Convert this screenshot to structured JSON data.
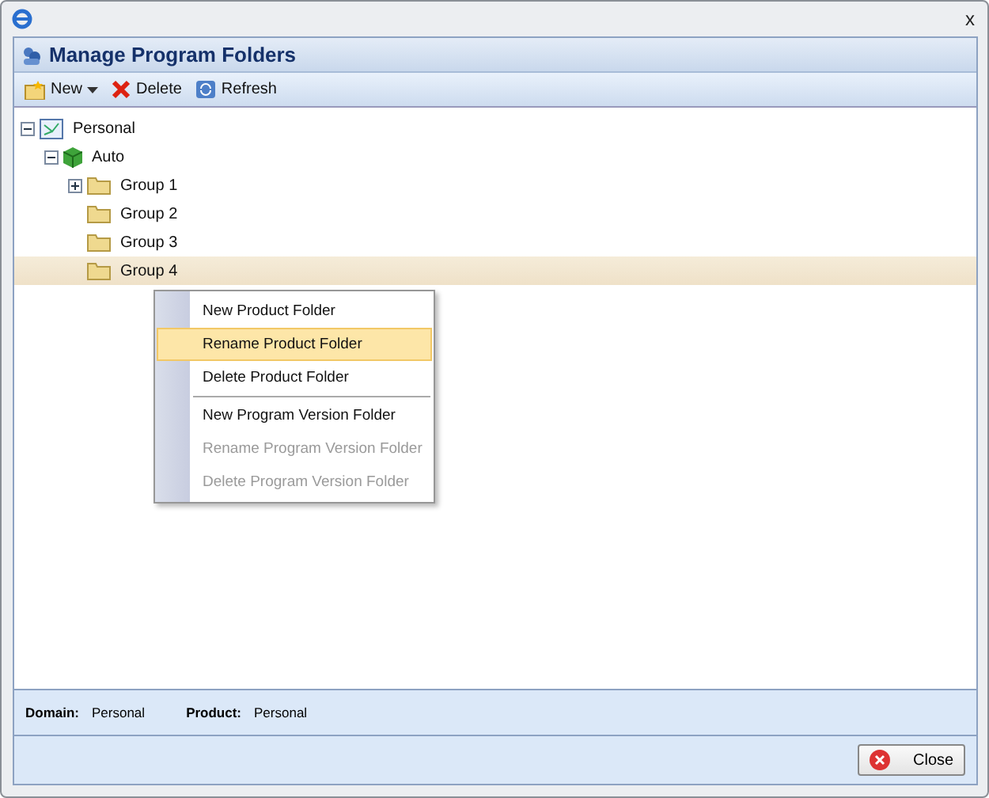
{
  "window": {
    "title": "Manage Program Folders",
    "close": "x"
  },
  "toolbar": [
    {
      "kind": "new",
      "label": "New",
      "dropdown": true
    },
    {
      "kind": "delete",
      "label": "Delete"
    },
    {
      "kind": "refresh",
      "label": "Refresh"
    }
  ],
  "tree": [
    {
      "label": "Personal",
      "kind": "domain",
      "expanded": true,
      "selected": false,
      "children": [
        {
          "label": "Auto",
          "kind": "product",
          "expanded": true,
          "selected": false,
          "children": [
            {
              "label": "Group 1",
              "kind": "folder",
              "expanded": false,
              "selected": false
            },
            {
              "label": "Group 2",
              "kind": "folder",
              "selected": false
            },
            {
              "label": "Group 3",
              "kind": "folder",
              "selected": false
            },
            {
              "label": "Group 4",
              "kind": "folder",
              "selected": true
            }
          ]
        }
      ]
    }
  ],
  "context_menu": {
    "groups": [
      [
        {
          "label": "New Product Folder",
          "selected": false,
          "disabled": false
        },
        {
          "label": "Rename Product Folder",
          "selected": true,
          "disabled": false
        },
        {
          "label": "Delete Product Folder",
          "selected": false,
          "disabled": false
        }
      ],
      [
        {
          "label": "New Program Version Folder",
          "selected": false,
          "disabled": false
        },
        {
          "label": "Rename Program Version Folder",
          "selected": false,
          "disabled": true
        },
        {
          "label": "Delete Program Version Folder",
          "selected": false,
          "disabled": true
        }
      ]
    ]
  },
  "info": [
    {
      "label": "Domain:",
      "value": "Personal"
    },
    {
      "label": "Product:",
      "value": "Personal"
    }
  ],
  "buttons": [
    {
      "kind": "close",
      "label": "Close"
    }
  ]
}
